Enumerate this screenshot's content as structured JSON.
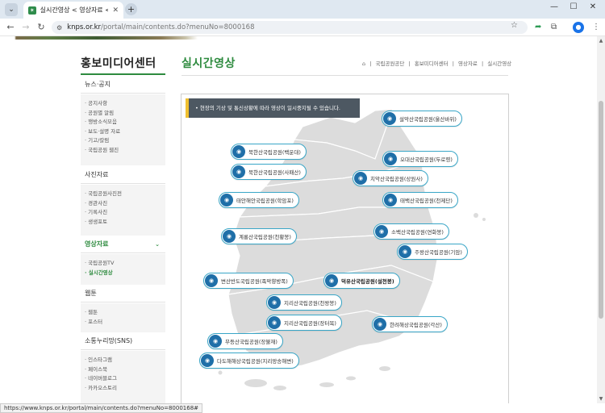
{
  "browser": {
    "tab_title": "실시간영상 < 영상자료 < 홍보미디...",
    "url_host": "knps.or.kr",
    "url_path": "/portal/main/contents.do?menuNo=8000168",
    "status_url": "https://www.knps.or.kr/portal/main/contents.do?menuNo=8000168#"
  },
  "sidebar": {
    "title": "홍보미디어센터",
    "sections": [
      {
        "label": "뉴스·공지",
        "links": [
          "공지사항",
          "공원별 알림",
          "행방소식모음",
          "보도·설명 자료",
          "기고/칼럼",
          "국립공원 웹진"
        ]
      },
      {
        "label": "사진자료",
        "links": [
          "국립공원사진전",
          "경관사진",
          "기록사진",
          "생생포토"
        ]
      },
      {
        "label": "영상자료",
        "links": [
          "국립공원TV",
          "실시간영상"
        ],
        "active": true,
        "current_link": "실시간영상"
      },
      {
        "label": "웹툰",
        "links": [
          "웹툰",
          "포스터"
        ]
      },
      {
        "label": "소통누리망(SNS)",
        "links": [
          "인스타그램",
          "페이스북",
          "네이버블로그",
          "카카오스토리"
        ]
      }
    ]
  },
  "main": {
    "title": "실시간영상",
    "breadcrumb": [
      "국립공원공단",
      "홍보미디어센터",
      "영상자료",
      "실시간영상"
    ],
    "notice": "현장의 기상 및 통신상황에 따라 영상이 일시중지될 수 있습니다."
  },
  "cameras": [
    {
      "label": "설악산국립공원(울산바위)"
    },
    {
      "label": "북한산국립공원(백운대)"
    },
    {
      "label": "오대산국립공원(두로령)"
    },
    {
      "label": "북한산국립공원(사패산)"
    },
    {
      "label": "치악산국립공원(상원사)"
    },
    {
      "label": "태안해안국립공원(학암포)"
    },
    {
      "label": "태백산국립공원(천제단)"
    },
    {
      "label": "소백산국립공원(연화봉)"
    },
    {
      "label": "계룡산국립공원(천황봉)"
    },
    {
      "label": "주왕산국립공원(기암)"
    },
    {
      "label": "변산반도국립공원(족막향방폭)"
    },
    {
      "label": "덕유산국립공원(설천봉)"
    },
    {
      "label": "지리산국립공원(천왕봉)"
    },
    {
      "label": "지리산국립공원(장터목)"
    },
    {
      "label": "한려해상국립공원(각산)"
    },
    {
      "label": "무등산국립공원(장불재)"
    },
    {
      "label": "다도해해상국립공원(지리망송해변)"
    }
  ]
}
